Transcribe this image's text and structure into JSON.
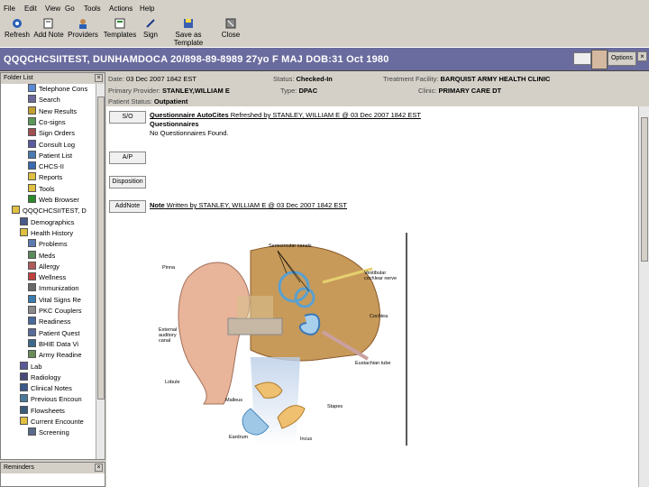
{
  "menu": [
    "File",
    "Edit",
    "View",
    "Go",
    "Tools",
    "Actions",
    "Help"
  ],
  "toolbar": [
    "Refresh",
    "Add Note",
    "Providers",
    "Templates",
    "Sign",
    "Save as Template",
    "Close"
  ],
  "banner": {
    "patient": "QQQCHCSIITEST, DUNHAMDOCA",
    "id": "20/898-89-8989",
    "age": "27yo",
    "sex": "F",
    "rank": "MAJ",
    "dob": "DOB:31 Oct 1980",
    "options": "Options",
    "close": "×"
  },
  "folder_list": {
    "title": "Folder List",
    "close": "×",
    "items": [
      "Telephone Cons",
      "Search",
      "New Results",
      "Co-signs",
      "Sign Orders",
      "Consult Log",
      "Patient List",
      "CHCS-II",
      "Reports",
      "Tools",
      "Web Browser",
      "QQQCHCSIITEST, D",
      "Demographics",
      "Health History",
      "Problems",
      "Meds",
      "Allergy",
      "Wellness",
      "Immunization",
      "Vital Signs Re",
      "PKC Couplers",
      "Readiness",
      "Patient Quest",
      "BHIE Data Vi",
      "Army Readine",
      "Lab",
      "Radiology",
      "Clinical Notes",
      "Previous Encoun",
      "Flowsheets",
      "Current Encounte",
      "Screening"
    ]
  },
  "reminders": {
    "title": "Reminders",
    "close": "×"
  },
  "encounter": {
    "date_label": "Date:",
    "date": "03 Dec 2007 1842 EST",
    "status_label": "Status:",
    "status": "Checked-In",
    "facility_label": "Treatment Facility:",
    "facility": "BARQUIST ARMY HEALTH CLINIC",
    "provider_label": "Primary Provider:",
    "provider": "STANLEY,WILLIAM E",
    "type_label": "Type:",
    "type": "DPAC",
    "clinic_label": "Clinic:",
    "clinic": "PRIMARY CARE DT",
    "pstatus_label": "Patient Status:",
    "pstatus": "Outpatient"
  },
  "note": {
    "so_btn": "S/O",
    "ap_btn": "A/P",
    "disp_btn": "Disposition",
    "addnote_btn": "AddNote",
    "questionnaire_link": "Questionnaire AutoCites",
    "refreshed": " Refreshed by STANLEY, WILLIAM E  @ 03 Dec 2007 1842 EST",
    "q_heading": "Questionnaires",
    "q_empty": "No Questionnaires Found.",
    "note_link": "Note",
    "note_written": " Written by STANLEY, WILLIAM E  @ 03 Dec 2007 1842 EST"
  },
  "figure_labels": {
    "semicircular": "Semicircular canals",
    "vestibular": "Vestibular cochlear nerve",
    "pinna": "Pinna",
    "cochlea": "Cochlea",
    "external": "External auditory canal",
    "eustachian": "Eustachian tube",
    "lobule": "Lobule",
    "malleus": "Malleus",
    "stapes": "Stapes",
    "eardrum": "Eardrum",
    "incus": "Incus"
  }
}
